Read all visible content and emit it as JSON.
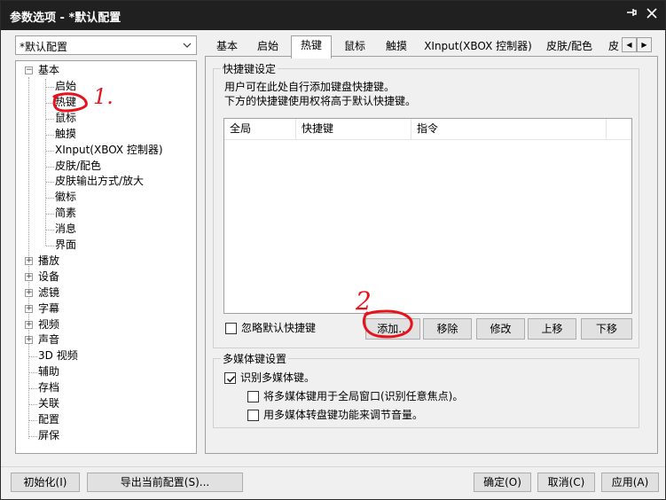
{
  "window": {
    "title": "参数选项 - *默认配置",
    "pin_icon": "pin-icon",
    "close_icon": "close-icon"
  },
  "profile_combo": {
    "value": "*默认配置"
  },
  "tree": {
    "basic": {
      "label": "基本",
      "expanded": true,
      "children": [
        "启始",
        "热键",
        "鼠标",
        "触摸",
        "XInput(XBOX 控制器)",
        "皮肤/配色",
        "皮肤输出方式/放大",
        "徽标",
        "简素",
        "消息",
        "界面"
      ]
    },
    "collapsed": [
      "播放",
      "设备",
      "滤镜",
      "字幕",
      "视频",
      "声音"
    ],
    "leaves": [
      "3D 视频",
      "辅助",
      "存档",
      "关联",
      "配置",
      "屏保"
    ],
    "selected": "热键"
  },
  "tabs": {
    "items": [
      "基本",
      "启始",
      "热键",
      "鼠标",
      "触摸",
      "XInput(XBOX 控制器)",
      "皮肤/配色",
      "皮"
    ],
    "active": "热键"
  },
  "hotkeys": {
    "group_title": "快捷键设定",
    "desc_line1": "用户可在此处自行添加键盘快捷键。",
    "desc_line2": "下方的快捷键使用权将高于默认快捷键。",
    "columns": [
      "全局",
      "快捷键",
      "指令"
    ],
    "ignore_default_label": "忽略默认快捷键",
    "ignore_default_checked": false,
    "buttons": {
      "add": "添加...",
      "remove": "移除",
      "edit": "修改",
      "up": "上移",
      "down": "下移"
    }
  },
  "media": {
    "group_title": "多媒体键设置",
    "recognize_label": "识别多媒体键。",
    "recognize_checked": true,
    "global_label": "将多媒体键用于全局窗口(识别任意焦点)。",
    "global_checked": false,
    "volume_label": "用多媒体转盘键功能来调节音量。",
    "volume_checked": false
  },
  "footer": {
    "init": "初始化(I)",
    "export": "导出当前配置(S)...",
    "ok": "确定(O)",
    "cancel": "取消(C)",
    "apply": "应用(A)"
  },
  "annotations": {
    "mark1": "1.",
    "mark2": "2",
    "color": "#e8121c"
  }
}
